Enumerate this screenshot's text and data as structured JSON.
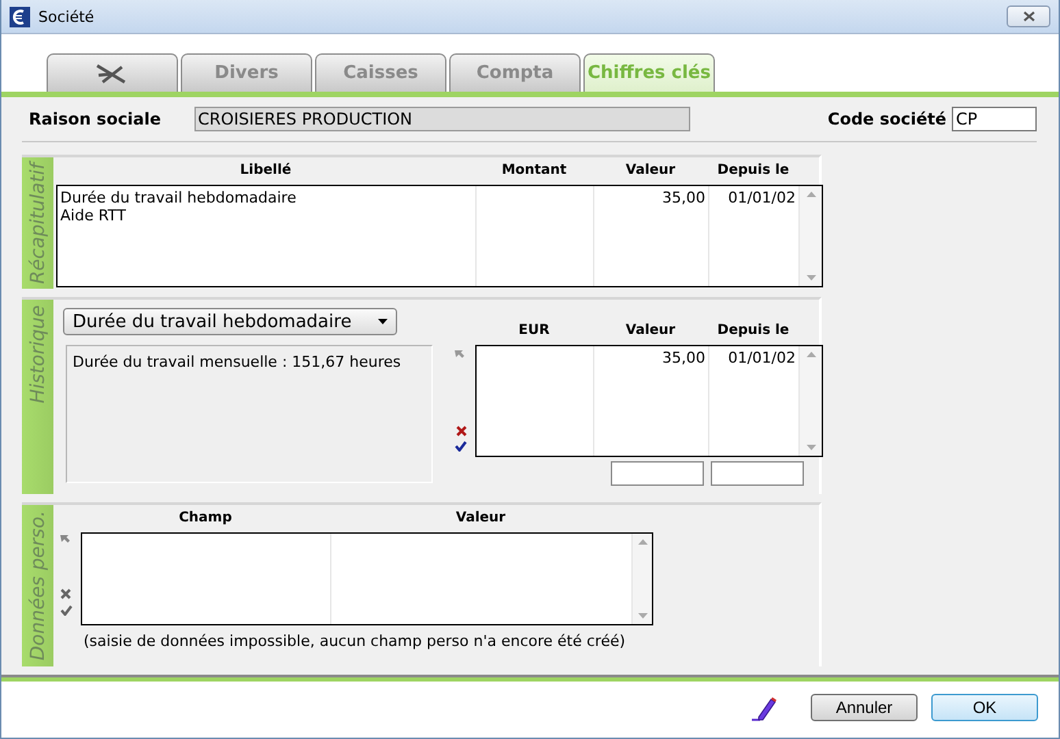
{
  "window": {
    "title": "Société"
  },
  "tabs": [
    {
      "kind": "icon",
      "selected": false
    },
    {
      "kind": "text",
      "label": "Divers",
      "selected": false
    },
    {
      "kind": "text",
      "label": "Caisses",
      "selected": false
    },
    {
      "kind": "text",
      "label": "Compta",
      "selected": false
    },
    {
      "kind": "text",
      "label": "Chiffres clés",
      "selected": true
    }
  ],
  "header": {
    "raison_sociale": {
      "label": "Raison sociale",
      "value": "CROISIERES PRODUCTION"
    },
    "code_societe": {
      "label": "Code société",
      "value": "CP"
    }
  },
  "recapitulatif": {
    "title": "Récapitulatif",
    "columns": [
      "Libellé",
      "Montant",
      "Valeur",
      "Depuis le"
    ],
    "rows": [
      {
        "libelle": "Durée du travail hebdomadaire",
        "valeur": "35,00",
        "depuis_le": "01/01/02"
      },
      {
        "libelle": "Aide RTT"
      }
    ]
  },
  "historique": {
    "title": "Historique",
    "dropdown": {
      "value": "Durée du travail hebdomadaire"
    },
    "info": "Durée du travail mensuelle : 151,67 heures",
    "columns": [
      "EUR",
      "Valeur",
      "Depuis le"
    ],
    "rows": [
      {
        "valeur": "35,00",
        "depuis_le": "01/01/02"
      }
    ]
  },
  "donnees_perso": {
    "title": "Données perso.",
    "columns": [
      "Champ",
      "Valeur"
    ],
    "note": "(saisie de données impossible, aucun champ perso n'a encore été créé)"
  },
  "buttons": [
    {
      "label": "Annuler",
      "default": false
    },
    {
      "label": "OK",
      "default": true
    }
  ]
}
